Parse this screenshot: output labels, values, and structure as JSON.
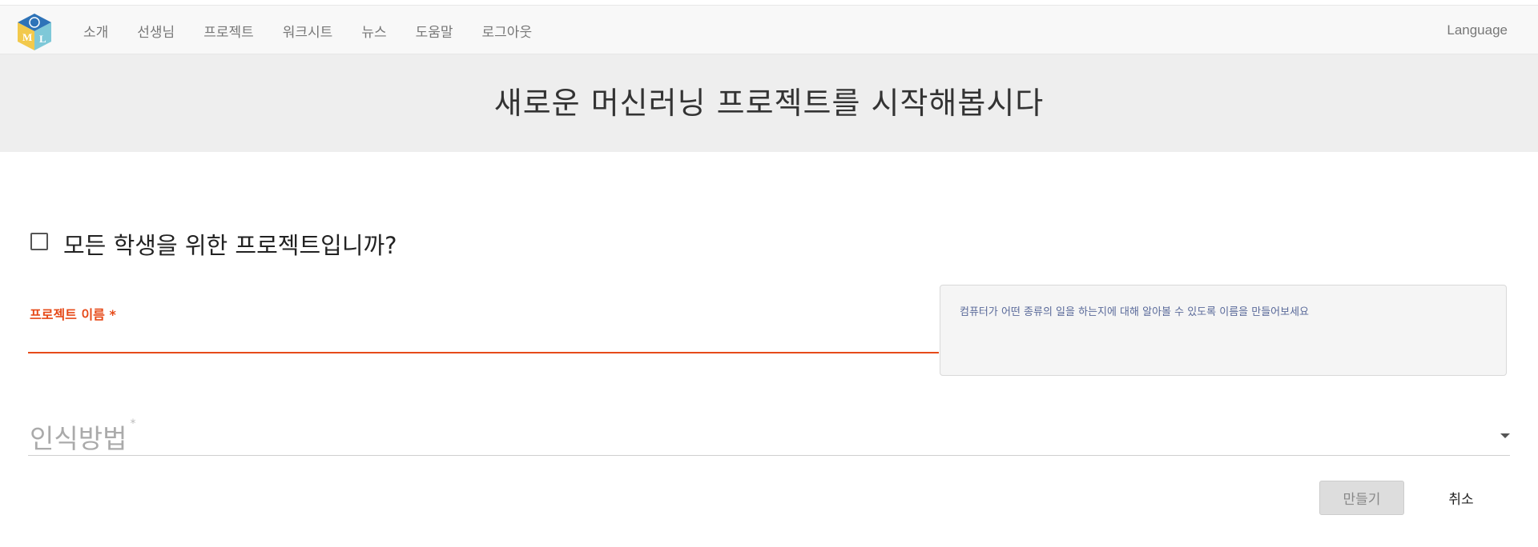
{
  "navbar": {
    "logo_name": "ml-logo-cube",
    "items": [
      {
        "label": "소개"
      },
      {
        "label": "선생님"
      },
      {
        "label": "프로젝트"
      },
      {
        "label": "워크시트"
      },
      {
        "label": "뉴스"
      },
      {
        "label": "도움말"
      },
      {
        "label": "로그아웃"
      }
    ],
    "language_label": "Language"
  },
  "header": {
    "title": "새로운 머신러닝 프로젝트를 시작해봅시다"
  },
  "form": {
    "crowd_checkbox": {
      "label": "모든 학생을 위한 프로젝트입니까?",
      "checked": false
    },
    "project_name": {
      "label": "프로젝트 이름 *",
      "value": "",
      "accent_color": "#e64a19"
    },
    "help": {
      "text": "컴퓨터가 어떤 종류의 일을 하는지에 대해 알아볼 수 있도록 이름을 만들어보세요"
    },
    "recognition_type": {
      "label": "인식방법",
      "required_marker": "*",
      "selected": ""
    },
    "buttons": {
      "create_label": "만들기",
      "cancel_label": "취소"
    }
  }
}
